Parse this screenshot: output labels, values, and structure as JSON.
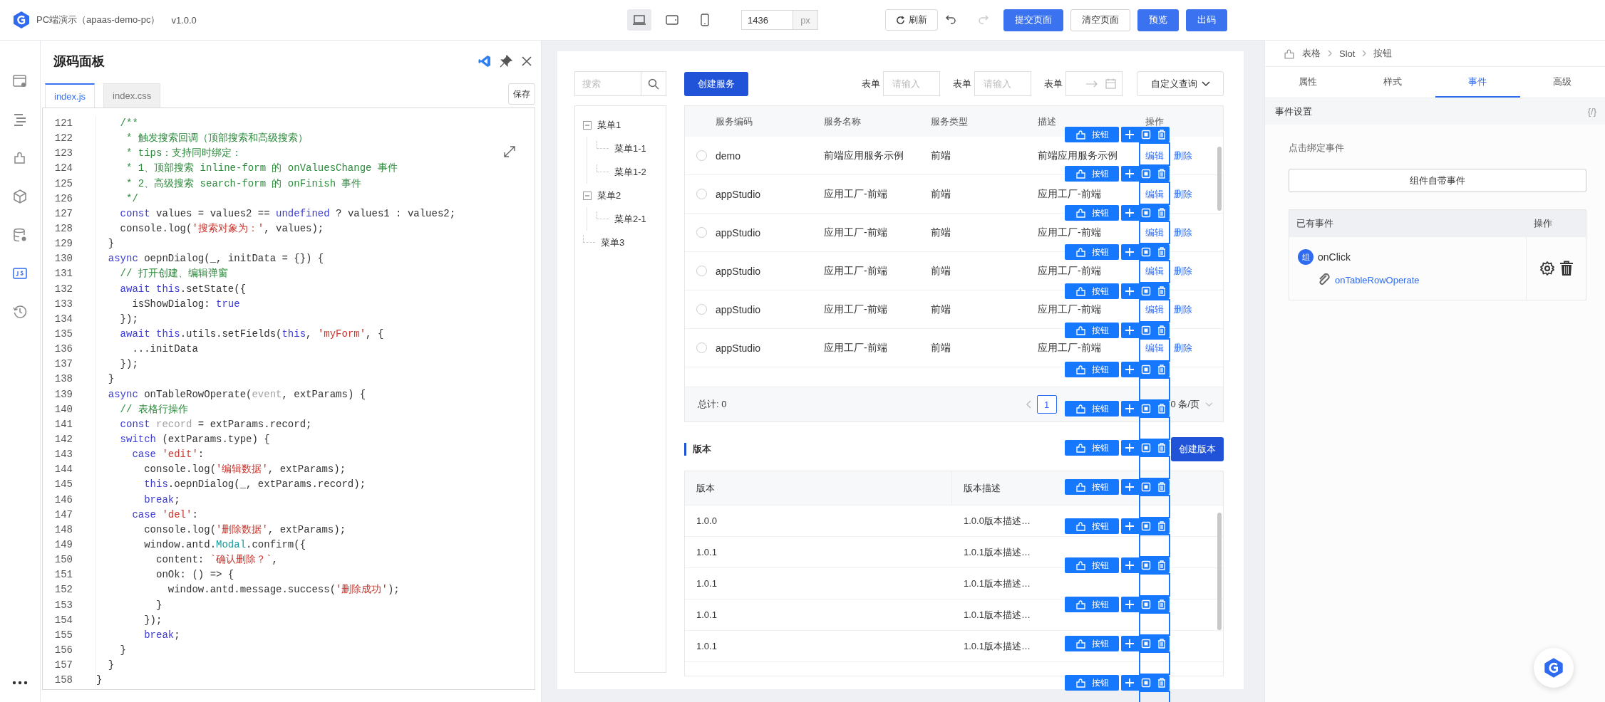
{
  "app": {
    "title": "PC端演示（apaas-demo-pc）",
    "version": "v1.0.0"
  },
  "toolbar": {
    "devices": [
      {
        "kind": "desktop",
        "selected": true
      },
      {
        "kind": "tablet",
        "selected": false
      },
      {
        "kind": "mobile",
        "selected": false
      }
    ],
    "width_field": {
      "value": "1436",
      "unit": "px"
    },
    "refresh": "刷新",
    "history": [
      {
        "kind": "undo",
        "disabled": false
      },
      {
        "kind": "redo",
        "disabled": true
      }
    ],
    "actions": [
      {
        "label": "提交页面",
        "primary": true
      },
      {
        "label": "清空页面",
        "primary": false
      },
      {
        "label": "预览",
        "primary": true
      },
      {
        "label": "出码",
        "primary": true
      }
    ]
  },
  "side_rail": {
    "items": [
      {
        "kind": "page",
        "selected": false
      },
      {
        "kind": "outline",
        "selected": false
      },
      {
        "kind": "component",
        "selected": false
      },
      {
        "kind": "cube",
        "selected": false
      },
      {
        "kind": "database",
        "selected": false
      },
      {
        "kind": "script",
        "selected": true
      },
      {
        "kind": "history",
        "selected": false
      }
    ]
  },
  "code_panel": {
    "title": "源码面板",
    "tabs": [
      {
        "label": "index.js",
        "selected": true
      },
      {
        "label": "index.css",
        "selected": false
      }
    ],
    "save": "保存",
    "lines": [
      {
        "number": "121",
        "tokens": [
          {
            "kind": "comment",
            "text": "    /**"
          }
        ]
      },
      {
        "number": "122",
        "tokens": [
          {
            "kind": "comment",
            "text": "     * 触发搜索回调（顶部搜索和高级搜索）"
          }
        ]
      },
      {
        "number": "123",
        "tokens": [
          {
            "kind": "comment",
            "text": "     * tips：支持同时绑定："
          }
        ]
      },
      {
        "number": "124",
        "tokens": [
          {
            "kind": "comment",
            "text": "     * 1、顶部搜索 inline-form 的 onValuesChange 事件"
          }
        ]
      },
      {
        "number": "125",
        "tokens": [
          {
            "kind": "comment",
            "text": "     * 2、高级搜索 search-form 的 onFinish 事件"
          }
        ]
      },
      {
        "number": "126",
        "tokens": [
          {
            "kind": "comment",
            "text": "     */"
          }
        ]
      },
      {
        "number": "127",
        "tokens": [
          {
            "kind": "kw",
            "text": "    const"
          },
          {
            "kind": "plain",
            "text": " values = values2 == "
          },
          {
            "kind": "kw",
            "text": "undefined"
          },
          {
            "kind": "plain",
            "text": " ? values1 : values2;"
          }
        ]
      },
      {
        "number": "128",
        "tokens": [
          {
            "kind": "plain",
            "text": "    console.log("
          },
          {
            "kind": "str",
            "text": "'搜索对象为：'"
          },
          {
            "kind": "plain",
            "text": ", values);"
          }
        ]
      },
      {
        "number": "129",
        "tokens": [
          {
            "kind": "plain",
            "text": "  }"
          }
        ]
      },
      {
        "number": "130",
        "tokens": [
          {
            "kind": "kw",
            "text": "  async"
          },
          {
            "kind": "plain",
            "text": " oepnDialog(_, initData = {}) {"
          }
        ]
      },
      {
        "number": "131",
        "tokens": [
          {
            "kind": "comment",
            "text": "    // 打开创建、编辑弹窗"
          }
        ]
      },
      {
        "number": "132",
        "tokens": [
          {
            "kind": "kw",
            "text": "    await this"
          },
          {
            "kind": "plain",
            "text": ".setState({"
          }
        ]
      },
      {
        "number": "133",
        "tokens": [
          {
            "kind": "plain",
            "text": "      isShowDialog: "
          },
          {
            "kind": "kw",
            "text": "true"
          }
        ]
      },
      {
        "number": "134",
        "tokens": [
          {
            "kind": "plain",
            "text": "    });"
          }
        ]
      },
      {
        "number": "135",
        "tokens": [
          {
            "kind": "kw",
            "text": "    await this"
          },
          {
            "kind": "plain",
            "text": ".utils.setFields("
          },
          {
            "kind": "kw",
            "text": "this"
          },
          {
            "kind": "plain",
            "text": ", "
          },
          {
            "kind": "str",
            "text": "'myForm'"
          },
          {
            "kind": "plain",
            "text": ", {"
          }
        ]
      },
      {
        "number": "136",
        "tokens": [
          {
            "kind": "plain",
            "text": "      ...initData"
          }
        ]
      },
      {
        "number": "137",
        "tokens": [
          {
            "kind": "plain",
            "text": "    });"
          }
        ]
      },
      {
        "number": "138",
        "tokens": [
          {
            "kind": "plain",
            "text": "  }"
          }
        ]
      },
      {
        "number": "139",
        "tokens": [
          {
            "kind": "kw",
            "text": "  async"
          },
          {
            "kind": "plain",
            "text": " onTableRowOperate("
          },
          {
            "kind": "dim",
            "text": "event"
          },
          {
            "kind": "plain",
            "text": ", extParams) {"
          }
        ]
      },
      {
        "number": "140",
        "tokens": [
          {
            "kind": "comment",
            "text": "    // 表格行操作"
          }
        ]
      },
      {
        "number": "141",
        "tokens": [
          {
            "kind": "kw",
            "text": "    const"
          },
          {
            "kind": "dim",
            "text": " record"
          },
          {
            "kind": "plain",
            "text": " = extParams.record;"
          }
        ]
      },
      {
        "number": "142",
        "tokens": [
          {
            "kind": "kw",
            "text": "    switch"
          },
          {
            "kind": "plain",
            "text": " (extParams.type) {"
          }
        ]
      },
      {
        "number": "143",
        "tokens": [
          {
            "kind": "kw",
            "text": "      case"
          },
          {
            "kind": "str",
            "text": " 'edit'"
          },
          {
            "kind": "plain",
            "text": ":"
          }
        ]
      },
      {
        "number": "144",
        "tokens": [
          {
            "kind": "plain",
            "text": "        console.log("
          },
          {
            "kind": "str",
            "text": "'编辑数据'"
          },
          {
            "kind": "plain",
            "text": ", extParams);"
          }
        ]
      },
      {
        "number": "145",
        "tokens": [
          {
            "kind": "kw",
            "text": "        this"
          },
          {
            "kind": "plain",
            "text": ".oepnDialog(_, extParams.record);"
          }
        ]
      },
      {
        "number": "146",
        "tokens": [
          {
            "kind": "kw",
            "text": "        break"
          },
          {
            "kind": "plain",
            "text": ";"
          }
        ]
      },
      {
        "number": "147",
        "tokens": [
          {
            "kind": "kw",
            "text": "      case"
          },
          {
            "kind": "str",
            "text": " 'del'"
          },
          {
            "kind": "plain",
            "text": ":"
          }
        ]
      },
      {
        "number": "148",
        "tokens": [
          {
            "kind": "plain",
            "text": "        console.log("
          },
          {
            "kind": "str",
            "text": "'删除数据'"
          },
          {
            "kind": "plain",
            "text": ", extParams);"
          }
        ]
      },
      {
        "number": "149",
        "tokens": [
          {
            "kind": "plain",
            "text": "        window.antd."
          },
          {
            "kind": "type",
            "text": "Modal"
          },
          {
            "kind": "plain",
            "text": ".confirm({"
          }
        ]
      },
      {
        "number": "150",
        "tokens": [
          {
            "kind": "plain",
            "text": "          content: "
          },
          {
            "kind": "str",
            "text": "`确认删除？`"
          },
          {
            "kind": "plain",
            "text": ","
          }
        ]
      },
      {
        "number": "151",
        "tokens": [
          {
            "kind": "plain",
            "text": "          onOk: () => {"
          }
        ]
      },
      {
        "number": "152",
        "tokens": [
          {
            "kind": "plain",
            "text": "            window.antd.message.success("
          },
          {
            "kind": "str",
            "text": "'删除成功'"
          },
          {
            "kind": "plain",
            "text": ");"
          }
        ]
      },
      {
        "number": "153",
        "tokens": [
          {
            "kind": "plain",
            "text": "          }"
          }
        ]
      },
      {
        "number": "154",
        "tokens": [
          {
            "kind": "plain",
            "text": "        });"
          }
        ]
      },
      {
        "number": "155",
        "tokens": [
          {
            "kind": "kw",
            "text": "        break"
          },
          {
            "kind": "plain",
            "text": ";"
          }
        ]
      },
      {
        "number": "156",
        "tokens": [
          {
            "kind": "plain",
            "text": "    }"
          }
        ]
      },
      {
        "number": "157",
        "tokens": [
          {
            "kind": "plain",
            "text": "  }"
          }
        ]
      },
      {
        "number": "158",
        "tokens": [
          {
            "kind": "plain",
            "text": "}"
          }
        ]
      }
    ]
  },
  "canvas": {
    "search": {
      "placeholder": "搜索"
    },
    "tree": [
      {
        "label": "菜单1",
        "expanded": true,
        "children": [
          {
            "label": "菜单1-1"
          },
          {
            "label": "菜单1-2"
          }
        ]
      },
      {
        "label": "菜单2",
        "expanded": true,
        "children": [
          {
            "label": "菜单2-1"
          }
        ]
      },
      {
        "label": "菜单3"
      }
    ],
    "create_button": "创建服务",
    "filters": [
      {
        "kind": "text",
        "label": "表单",
        "placeholder": "请输入"
      },
      {
        "kind": "text",
        "label": "表单",
        "placeholder": "请输入"
      },
      {
        "kind": "date_range",
        "label": "表单"
      }
    ],
    "custom_query": "自定义查询",
    "service_table": {
      "columns": [
        "服务编码",
        "服务名称",
        "服务类型",
        "描述",
        "操作"
      ],
      "rows": [
        {
          "selected": false,
          "cells": [
            "demo",
            "前端应用服务示例",
            "前端",
            "前端应用服务示例"
          ],
          "actions": [
            "编辑",
            "删除"
          ]
        },
        {
          "selected": false,
          "cells": [
            "appStudio",
            "应用工厂-前端",
            "前端",
            "应用工厂-前端"
          ],
          "actions": [
            "编辑",
            "删除"
          ]
        },
        {
          "selected": false,
          "cells": [
            "appStudio",
            "应用工厂-前端",
            "前端",
            "应用工厂-前端"
          ],
          "actions": [
            "编辑",
            "删除"
          ]
        },
        {
          "selected": false,
          "cells": [
            "appStudio",
            "应用工厂-前端",
            "前端",
            "应用工厂-前端"
          ],
          "actions": [
            "编辑",
            "删除"
          ]
        },
        {
          "selected": false,
          "cells": [
            "appStudio",
            "应用工厂-前端",
            "前端",
            "应用工厂-前端"
          ],
          "actions": [
            "编辑",
            "删除"
          ]
        },
        {
          "selected": false,
          "cells": [
            "appStudio",
            "应用工厂-前端",
            "前端",
            "应用工厂-前端"
          ],
          "actions": [
            "编辑",
            "删除"
          ]
        }
      ],
      "total": "总计: 0",
      "page": "1",
      "page_size": "0 条/页"
    },
    "version_section": {
      "title": "版本",
      "create_button": "创建版本",
      "columns": [
        "版本",
        "版本描述"
      ],
      "rows": [
        [
          "1.0.0",
          "1.0.0版本描述…"
        ],
        [
          "1.0.1",
          "1.0.1版本描述…"
        ],
        [
          "1.0.1",
          "1.0.1版本描述…"
        ],
        [
          "1.0.1",
          "1.0.1版本描述…"
        ],
        [
          "1.0.1",
          "1.0.1版本描述…"
        ]
      ]
    },
    "slot_overlay": {
      "tags": [
        "按钮",
        "按钮",
        "按钮",
        "按钮",
        "按钮",
        "按钮",
        "按钮",
        "按钮",
        "按钮",
        "按钮",
        "按钮",
        "按钮",
        "按钮",
        "按钮",
        "按钮"
      ]
    }
  },
  "inspector": {
    "breadcrumb": [
      "表格",
      "Slot",
      "按钮"
    ],
    "tabs": [
      {
        "label": "属性",
        "selected": false
      },
      {
        "label": "样式",
        "selected": false
      },
      {
        "label": "事件",
        "selected": true
      },
      {
        "label": "高级",
        "selected": false
      }
    ],
    "section": "事件设置",
    "code_toggle": "{/}",
    "bind_label": "点击绑定事件",
    "builtin_button": "组件自带事件",
    "events_table": {
      "columns": [
        "已有事件",
        "操作"
      ],
      "rows": [
        {
          "badge": "组",
          "event": "onClick",
          "handler": "onTableRowOperate"
        }
      ]
    }
  }
}
